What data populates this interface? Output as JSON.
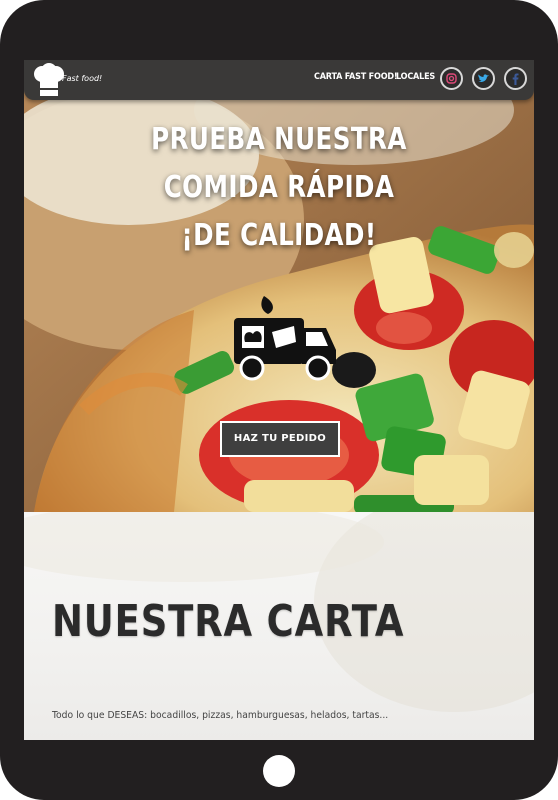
{
  "navbar": {
    "brand": "Fast food!",
    "links": [
      "CARTA FAST FOOD!",
      "LOCALES"
    ],
    "social_icons": [
      "instagram-icon",
      "twitter-icon",
      "facebook-icon"
    ],
    "colors": {
      "bar": "#3a3938",
      "text": "#ffffff"
    }
  },
  "hero": {
    "title": "PRUEBA NUESTRA COMIDA RÁPIDA ¡DE CALIDAD!",
    "icon": "food-truck-icon",
    "button_label": "HAZ TU PEDIDO"
  },
  "section": {
    "title": "NUESTRA CARTA",
    "text": "Todo lo que DESEAS: bocadillos, pizzas, hamburguesas, helados, tartas..."
  },
  "colors": {
    "frame": "#221f20",
    "button_bg": "#3f3f3f",
    "title_dark": "#2b2b2b"
  }
}
